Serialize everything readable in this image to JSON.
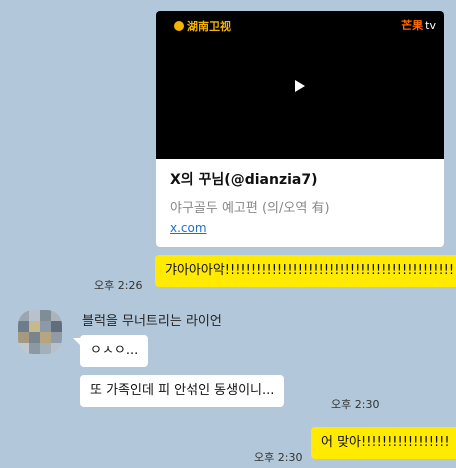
{
  "preview_card": {
    "logo_left": "湖南卫视",
    "logo_right_brand": "芒果",
    "logo_right_tv": "tv",
    "title": "X의 꾸님(@dianzia7)",
    "subtitle": "야구골두 예고편 (의/오역 有)",
    "link": "x.com"
  },
  "messages": {
    "msg1": {
      "time": "오후 2:26",
      "text": "갸아아아악!!!!!!!!!!!!!!!!!!!!!!!!!!!!!!!!!!!!!!!!!!!!!!"
    },
    "sender_name": "블럭을 무너트리는 라이언",
    "msg2": {
      "text": "ㅇㅅㅇ..."
    },
    "msg3": {
      "time": "오후 2:30",
      "text": "또 가족인데 피 안섞인 동생이니..."
    },
    "msg4": {
      "time": "오후 2:30",
      "text": "어 맞아!!!!!!!!!!!!!!!!!"
    }
  },
  "colors": {
    "background": "#b2c7d9",
    "my_bubble": "#ffea00",
    "their_bubble": "#ffffff",
    "link": "#1a73c8"
  }
}
